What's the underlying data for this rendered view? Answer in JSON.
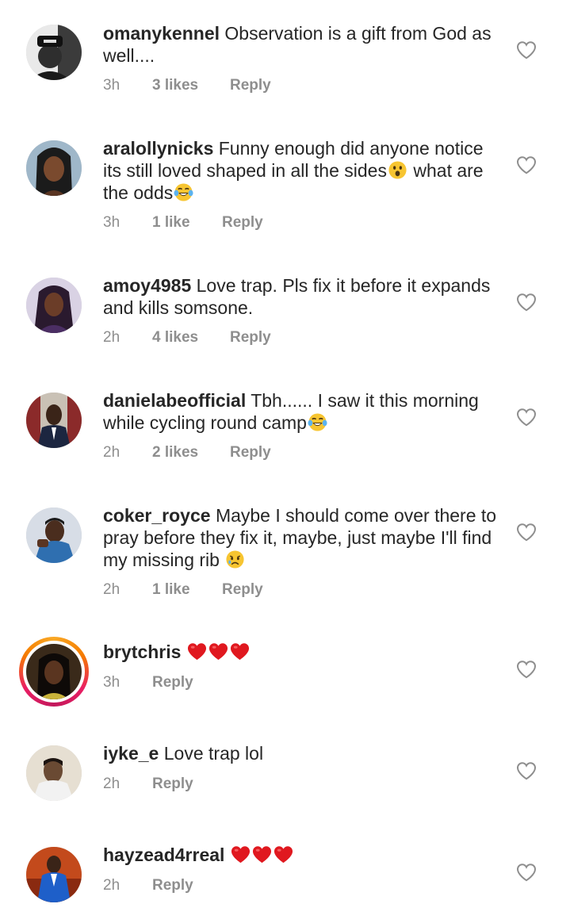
{
  "comments": [
    {
      "username": "omanykennel",
      "text": "Observation is a gift from God as well....",
      "time": "3h",
      "likes": "3 likes",
      "reply": "Reply",
      "avatar_icon": "user-photo-icon"
    },
    {
      "username": "aralollynicks",
      "text": "Funny enough did anyone notice its still loved shaped in all the sides",
      "text_after_emoji1": "what are the odds",
      "time": "3h",
      "likes": "1 like",
      "reply": "Reply",
      "emoji1": "astonished-face-icon",
      "emoji2": "tears-of-joy-icon",
      "avatar_icon": "user-photo-icon"
    },
    {
      "username": "amoy4985",
      "text": "Love trap. Pls fix it before it expands and kills somsone.",
      "time": "2h",
      "likes": "4 likes",
      "reply": "Reply",
      "avatar_icon": "user-photo-icon"
    },
    {
      "username": "danielabeofficial",
      "text": "Tbh...... I saw it this morning while cycling round camp",
      "time": "2h",
      "likes": "2 likes",
      "reply": "Reply",
      "emoji1": "tears-of-joy-icon",
      "avatar_icon": "user-photo-icon"
    },
    {
      "username": "coker_royce",
      "text": "Maybe I should come over there to pray before they fix it, maybe, just maybe I'll find my missing rib",
      "time": "2h",
      "likes": "1 like",
      "reply": "Reply",
      "emoji1": "sad-face-icon",
      "avatar_icon": "user-photo-icon"
    },
    {
      "username": "brytchris",
      "text": "",
      "time": "3h",
      "reply": "Reply",
      "emoji": "red-heart-icon",
      "avatar_icon": "user-photo-icon"
    },
    {
      "username": "iyke_e",
      "text": "Love trap lol",
      "time": "2h",
      "reply": "Reply",
      "avatar_icon": "user-photo-icon"
    },
    {
      "username": "hayzead4rreal",
      "text": "",
      "time": "2h",
      "reply": "Reply",
      "emoji": "red-heart-icon",
      "avatar_icon": "user-photo-icon"
    }
  ],
  "colors": {
    "text": "#262626",
    "meta": "#8e8e8e",
    "heart_outline": "#8e8e8e",
    "emoji_heart": "#e0181f"
  },
  "icons": {
    "like": "heart-outline-icon"
  }
}
